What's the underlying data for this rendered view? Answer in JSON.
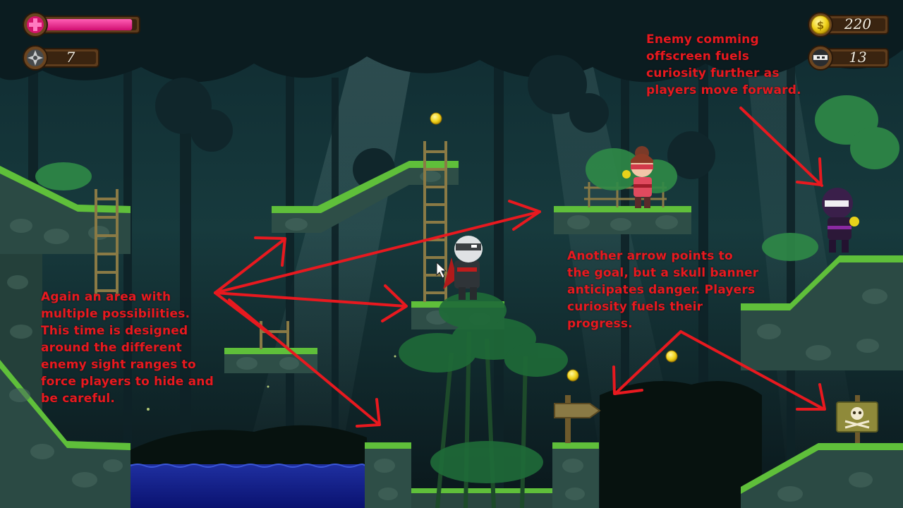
{
  "hud": {
    "health_level": 0.95,
    "shuriken_count": "7",
    "coin_count": "220",
    "enemies_remaining": "13",
    "health_color": "#e8157f",
    "icons": [
      "health-cross-icon",
      "shuriken-icon",
      "coin-icon",
      "ninja-mask-icon"
    ]
  },
  "annotations": {
    "left_note": "Again an area with\nmultiple possibilities.\nThis time is designed\naround the different\nenemy sight ranges to\nforce players to hide and\nbe careful.",
    "center_note": "Another arrow points to\nthe goal, but a skull banner\nanticipates danger. Players\ncuriosity fuels their\nprogress.",
    "top_right_note": "Enemy comming\noffscreen fuels\ncuriosity further as\nplayers move forward.",
    "color": "#e8191f"
  }
}
